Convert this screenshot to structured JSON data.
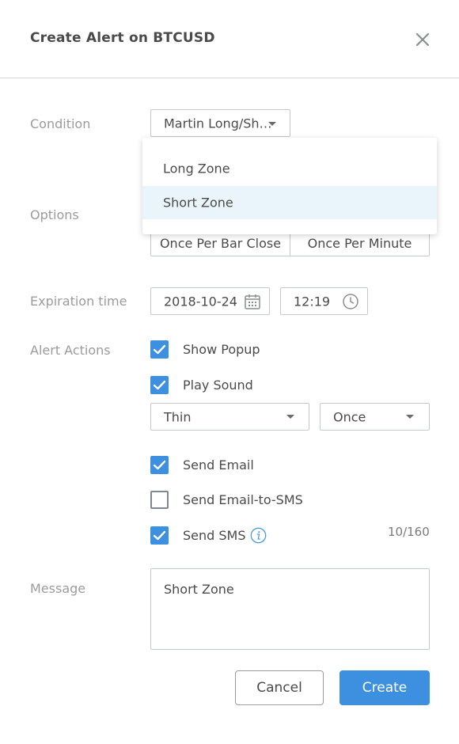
{
  "dialog": {
    "title": "Create Alert on BTCUSD",
    "close_icon": "close-icon"
  },
  "condition": {
    "label": "Condition",
    "selected": "Martin Long/Sh…",
    "options": [
      "Long Zone",
      "Short Zone"
    ],
    "highlighted": "Short Zone"
  },
  "options": {
    "label": "Options",
    "segments": [
      "Once Per Bar Close",
      "Once Per Minute"
    ]
  },
  "expiration": {
    "label": "Expiration time",
    "date": "2018-10-24",
    "date_icon": "calendar-icon",
    "time": "12:19",
    "time_icon": "clock-icon"
  },
  "actions": {
    "label": "Alert Actions",
    "show_popup": {
      "label": "Show Popup",
      "checked": true
    },
    "play_sound": {
      "label": "Play Sound",
      "checked": true
    },
    "sound_name": "Thin",
    "sound_repeat": "Once",
    "send_email": {
      "label": "Send Email",
      "checked": true
    },
    "send_email_sms": {
      "label": "Send Email-to-SMS",
      "checked": false
    },
    "send_sms": {
      "label": "Send SMS",
      "checked": true
    },
    "info_icon": "info-icon",
    "sms_counter": "10/160"
  },
  "message": {
    "label": "Message",
    "value": "Short Zone"
  },
  "buttons": {
    "cancel": "Cancel",
    "create": "Create"
  },
  "colors": {
    "accent": "#3d8fe0",
    "highlight": "#e9f5fb"
  }
}
